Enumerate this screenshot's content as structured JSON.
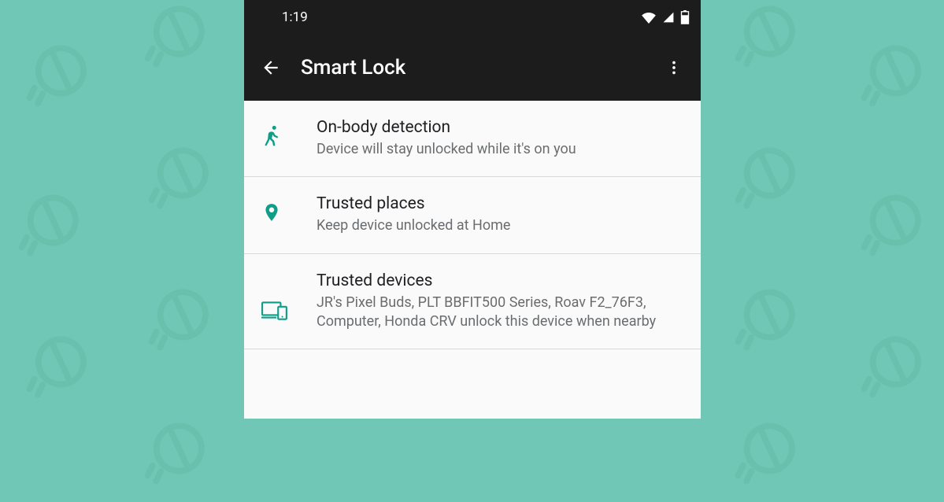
{
  "statusbar": {
    "time": "1:19"
  },
  "appbar": {
    "title": "Smart Lock"
  },
  "items": [
    {
      "icon": "walk-icon",
      "title": "On-body detection",
      "subtitle": "Device will stay unlocked while it's on you"
    },
    {
      "icon": "place-icon",
      "title": "Trusted places",
      "subtitle": "Keep device unlocked at Home"
    },
    {
      "icon": "devices-icon",
      "title": "Trusted devices",
      "subtitle": "JR's Pixel Buds, PLT BBFIT500 Series, Roav F2_76F3, Computer, Honda CRV unlock this device when nearby"
    }
  ],
  "colors": {
    "accent": "#0f9d87",
    "background": "#71c7b5"
  }
}
